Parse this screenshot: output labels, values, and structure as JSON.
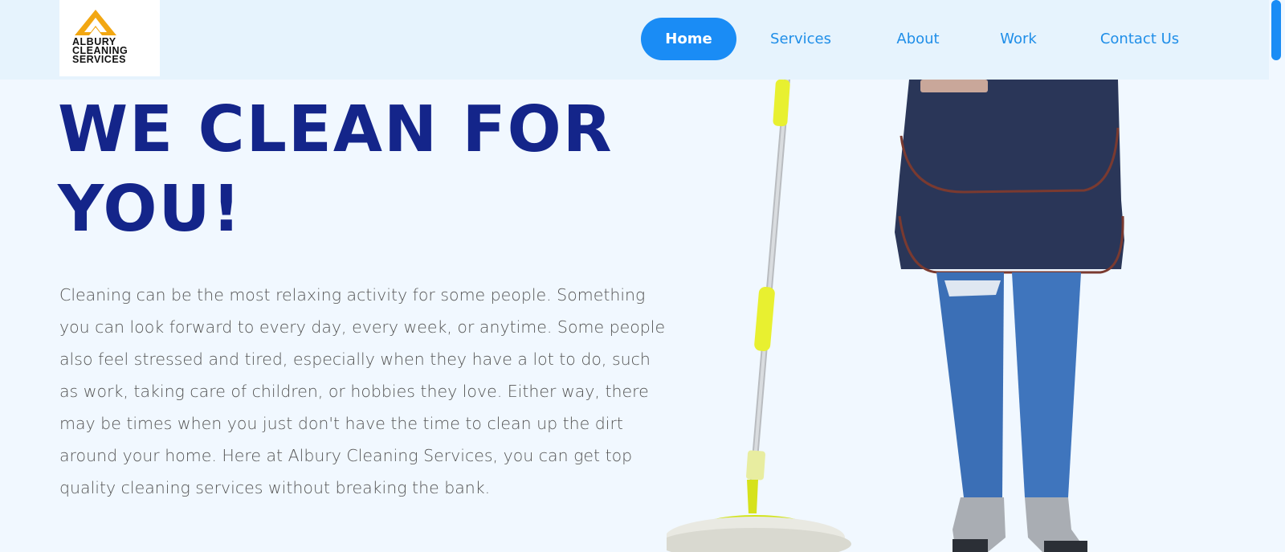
{
  "header": {
    "logo_lines": [
      "ALBURY",
      "CLEANING",
      "SERVICES"
    ],
    "nav": [
      {
        "label": "Home",
        "active": true
      },
      {
        "label": "Services",
        "active": false
      },
      {
        "label": "About",
        "active": false
      },
      {
        "label": "Work",
        "active": false
      },
      {
        "label": "Contact Us",
        "active": false
      }
    ]
  },
  "hero": {
    "title_lines": [
      "WE CLEAN FOR",
      "YOU!"
    ],
    "paragraph": "Cleaning can be the most relaxing activity for some people. Something you can look forward to every day, every week, or anytime. Some people also feel stressed and tired, especially when they have a lot to do, such as work, taking care of children, or hobbies they love. Either way, there may be times when you just don't have the time to clean up the dirt around your home. Here at Albury Cleaning Services, you can get top quality cleaning services without breaking the bank."
  },
  "colors": {
    "accent": "#1a8cf5",
    "title": "#14258a",
    "header_bg": "#e6f3fd",
    "page_bg": "#f1f8ff"
  }
}
